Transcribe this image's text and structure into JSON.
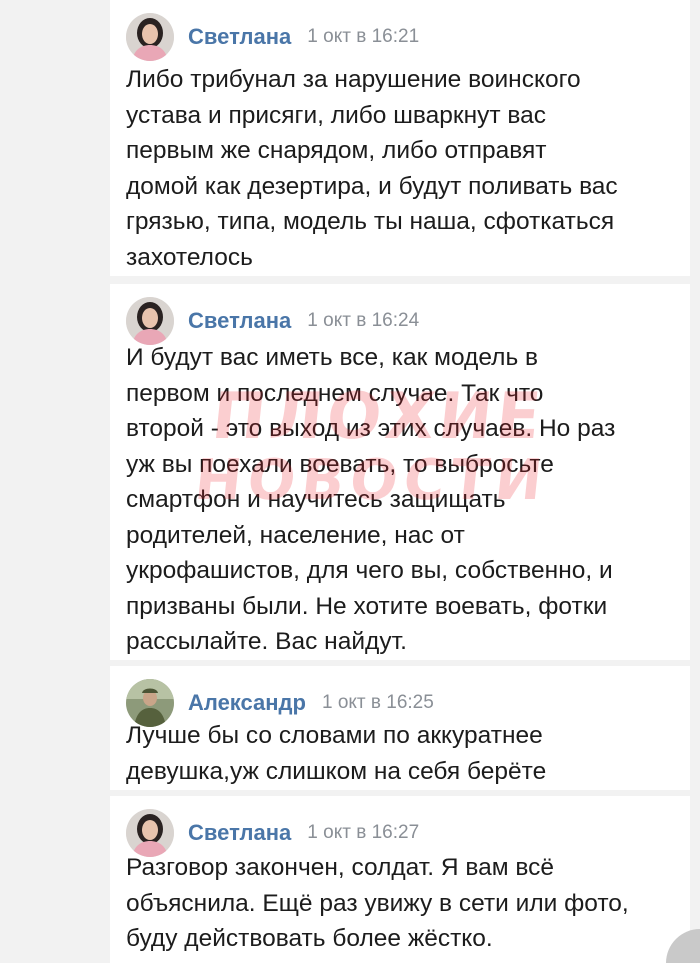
{
  "comments": [
    {
      "author": "Светлана",
      "time": "1 окт в 16:21",
      "avatar_icon": "woman-avatar",
      "text": "Либо трибунал за нарушение воинского\nустава и присяги, либо шваркнут вас\nпервым же снарядом, либо отправят\nдомой как дезертира, и будут поливать вас\nгрязью, типа, модель ты наша, сфоткаться\nзахотелось"
    },
    {
      "author": "Светлана",
      "time": "1 окт в 16:24",
      "avatar_icon": "woman-avatar",
      "text": "И будут вас иметь все, как модель в\nпервом и последнем случае. Так что\nвторой - это выход из этих случаев. Но раз\nуж вы поехали воевать, то выбросьте\nсмартфон и научитесь защищать\nродителей, население, нас от\nукрофашистов, для чего вы, собственно, и\nпризваны были. Не хотите воевать, фотки\nрассылайте. Вас найдут."
    },
    {
      "author": "Александр",
      "time": "1 окт в 16:25",
      "avatar_icon": "soldier-avatar",
      "text": "Лучше бы со словами по аккуратнее\nдевушка,уж слишком на себя берёте"
    },
    {
      "author": "Светлана",
      "time": "1 окт в 16:27",
      "avatar_icon": "woman-avatar",
      "text": "Разговор закончен, солдат. Я вам всё\nобъяснила. Ещё раз увижу в сети или фото,\nбуду действовать более жёстко."
    }
  ],
  "watermark": {
    "line1": "ПЛОХИЕ",
    "line2": "НОВОСТИ"
  },
  "colors": {
    "author": "#4a76a8",
    "meta": "#8a8f96",
    "text": "#1c1c1c",
    "card": "#ffffff",
    "background": "#f2f2f2"
  }
}
